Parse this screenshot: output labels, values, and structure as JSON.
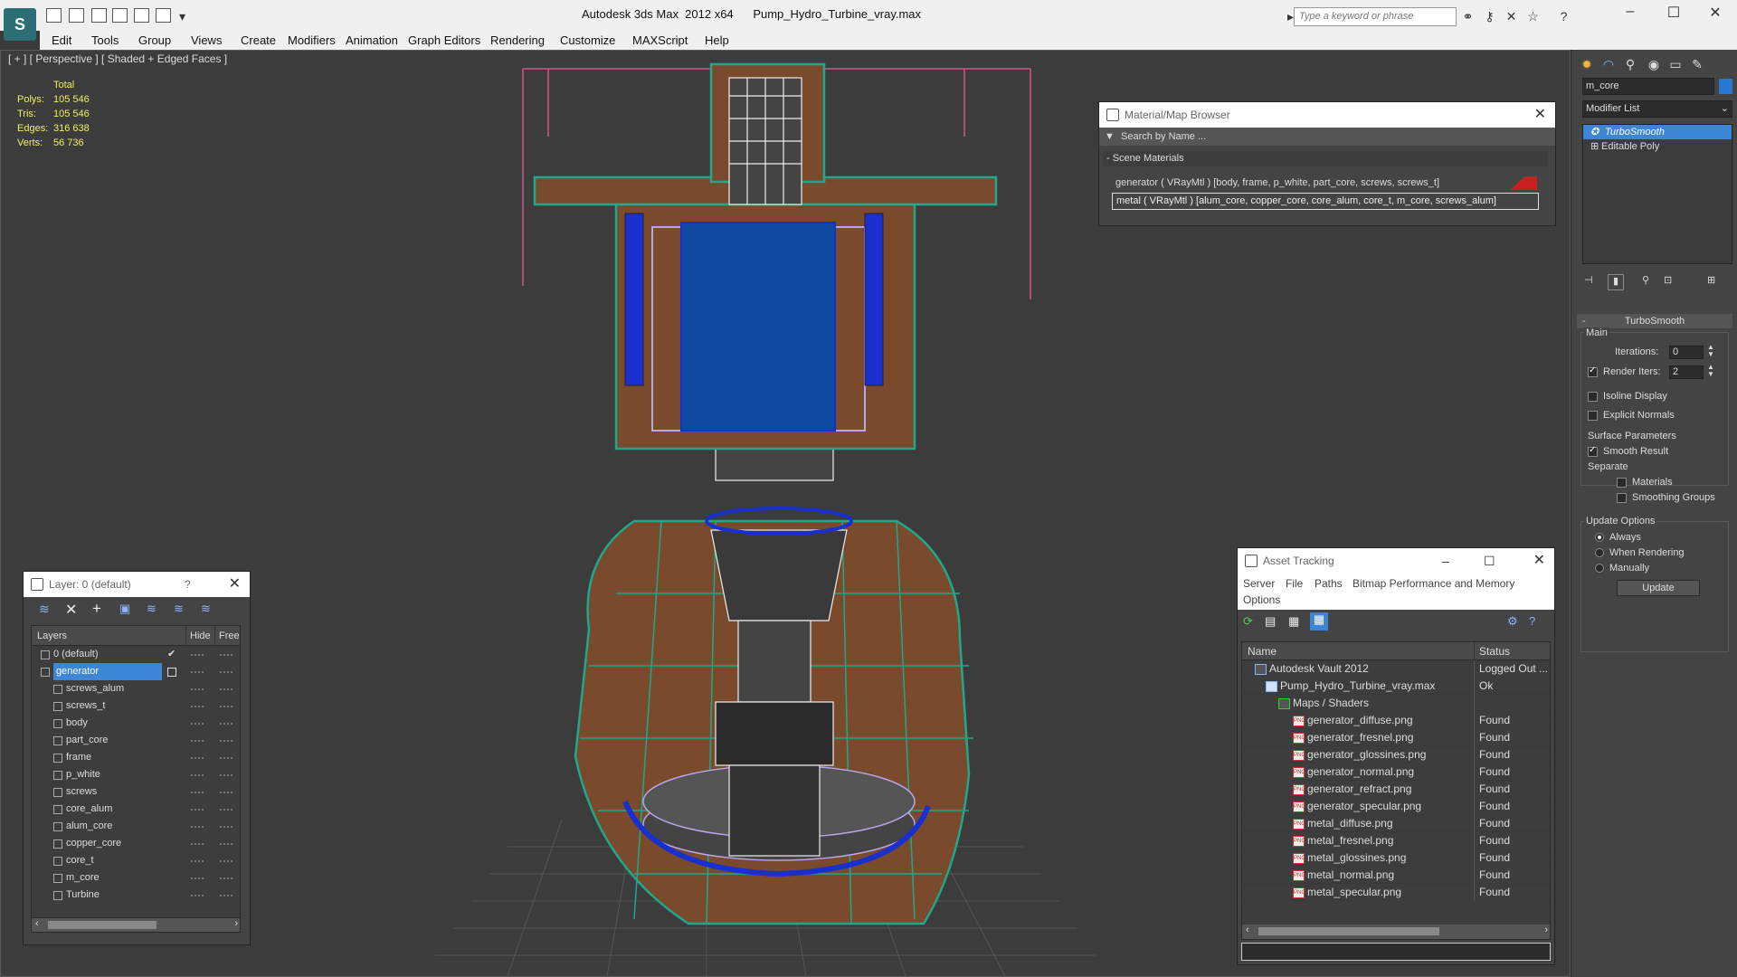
{
  "app": {
    "title": "Autodesk 3ds Max  2012 x64      Pump_Hydro_Turbine_vray.max",
    "search_placeholder": "Type a keyword or phrase",
    "logo_glyph": "S"
  },
  "menu": [
    "Edit",
    "Tools",
    "Group",
    "Views",
    "Create",
    "Modifiers",
    "Animation",
    "Graph Editors",
    "Rendering",
    "Customize",
    "MAXScript",
    "Help"
  ],
  "viewport": {
    "label": "[ + ] [ Perspective ] [ Shaded + Edged Faces ]",
    "stats": {
      "header": "Total",
      "rows": [
        {
          "label": "Polys:",
          "value": "105 546"
        },
        {
          "label": "Tris:",
          "value": "105 546"
        },
        {
          "label": "Edges:",
          "value": "316 638"
        },
        {
          "label": "Verts:",
          "value": "56 736"
        }
      ]
    }
  },
  "material_browser": {
    "title": "Material/Map Browser",
    "search_label": "Search by Name ...",
    "section": "- Scene Materials",
    "materials": [
      "generator  ( VRayMtl ) [body, frame, p_white, part_core, screws, screws_t]",
      "metal  ( VRayMtl ) [alum_core, copper_core, core_alum, core_t, m_core, screws_alum]"
    ]
  },
  "command_panel": {
    "object_name": "m_core",
    "modifier_list": "Modifier List",
    "stack": [
      "TurboSmooth",
      "Editable Poly"
    ],
    "rollout_title": "TurboSmooth",
    "main_label": "Main",
    "iterations_label": "Iterations:",
    "iterations_value": "0",
    "render_iters_label": "Render Iters:",
    "render_iters_value": "2",
    "isoline_label": "Isoline Display",
    "explicit_label": "Explicit Normals",
    "surface_label": "Surface Parameters",
    "smooth_label": "Smooth Result",
    "separate_label": "Separate",
    "materials_label": "Materials",
    "smoothing_label": "Smoothing Groups",
    "update_options_label": "Update Options",
    "always_label": "Always",
    "when_rendering_label": "When Rendering",
    "manually_label": "Manually",
    "update_button": "Update"
  },
  "layers_window": {
    "title": "Layer: 0 (default)",
    "help": "?",
    "columns": [
      "Layers",
      "Hide",
      "Freeze"
    ],
    "default_layer": "0 (default)",
    "selected_layer": "generator",
    "objects": [
      "screws_alum",
      "screws_t",
      "body",
      "part_core",
      "frame",
      "p_white",
      "screws",
      "core_alum",
      "alum_core",
      "copper_core",
      "core_t",
      "m_core",
      "Turbine"
    ]
  },
  "asset_tracking": {
    "title": "Asset Tracking",
    "menu": [
      "Server",
      "File",
      "Paths",
      "Bitmap Performance and Memory",
      "Options"
    ],
    "columns": [
      "Name",
      "Status"
    ],
    "rows": [
      {
        "name": "Autodesk Vault 2012",
        "status": "Logged Out ..."
      },
      {
        "name": "Pump_Hydro_Turbine_vray.max",
        "status": "Ok"
      },
      {
        "name": "Maps / Shaders",
        "status": ""
      },
      {
        "name": "generator_diffuse.png",
        "status": "Found"
      },
      {
        "name": "generator_fresnel.png",
        "status": "Found"
      },
      {
        "name": "generator_glossines.png",
        "status": "Found"
      },
      {
        "name": "generator_normal.png",
        "status": "Found"
      },
      {
        "name": "generator_refract.png",
        "status": "Found"
      },
      {
        "name": "generator_specular.png",
        "status": "Found"
      },
      {
        "name": "metal_diffuse.png",
        "status": "Found"
      },
      {
        "name": "metal_fresnel.png",
        "status": "Found"
      },
      {
        "name": "metal_glossines.png",
        "status": "Found"
      },
      {
        "name": "metal_normal.png",
        "status": "Found"
      },
      {
        "name": "metal_specular.png",
        "status": "Found"
      }
    ]
  },
  "colors": {
    "selection_blue": "#3d86d6",
    "wire_teal": "#1fa88c",
    "brown_face": "#7a4a2c",
    "blue_body": "#0f4aa0"
  }
}
